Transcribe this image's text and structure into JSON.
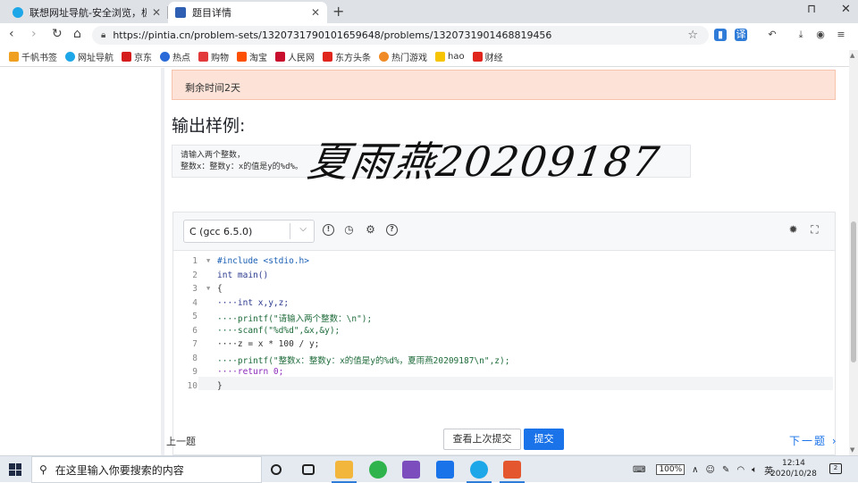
{
  "tabs": [
    {
      "title": "联想网址导航-安全浏览，极速体验",
      "active": false
    },
    {
      "title": "题目详情",
      "active": true
    }
  ],
  "address": {
    "url": "https://pintia.cn/problem-sets/1320731790101659648/problems/1320731901468819456"
  },
  "bookmarks": [
    "千帆书签",
    "网址导航",
    "京东",
    "热点",
    "购物",
    "淘宝",
    "人民网",
    "东方头条",
    "热门游戏",
    "hao",
    "财经"
  ],
  "page": {
    "notice": "剩余时间2天",
    "section_title": "输出样例:",
    "sample_output": [
      "请输入两个整数，",
      "整数x：整数y：x的值是y的%d%。"
    ],
    "signature": "夏雨燕20209187"
  },
  "editor": {
    "language": "C (gcc 6.5.0)",
    "line_numbers": [
      "1",
      "2",
      "3",
      "4",
      "5",
      "6",
      "7",
      "8",
      "9",
      "10"
    ],
    "lines": [
      "#include <stdio.h>",
      "int main()",
      "{",
      "····int x,y,z;",
      "····printf(\"请输入两个整数：\\n\");",
      "····scanf(\"%d%d\",&x,&y);",
      "····z = x * 100 / y;",
      "····printf(\"整数x：整数y：x的值是y的%d%，夏雨燕20209187\\n\",z);",
      "····return 0;",
      "}"
    ]
  },
  "footer": {
    "prev": "上一题",
    "view_last": "查看上次提交",
    "submit": "提交",
    "next": "下一题"
  },
  "taskbar": {
    "search_placeholder": "在这里输入你要搜索的内容",
    "battery": "100%",
    "ime": "英",
    "time": "12:14",
    "date": "2020/10/28",
    "notifications": "2"
  }
}
